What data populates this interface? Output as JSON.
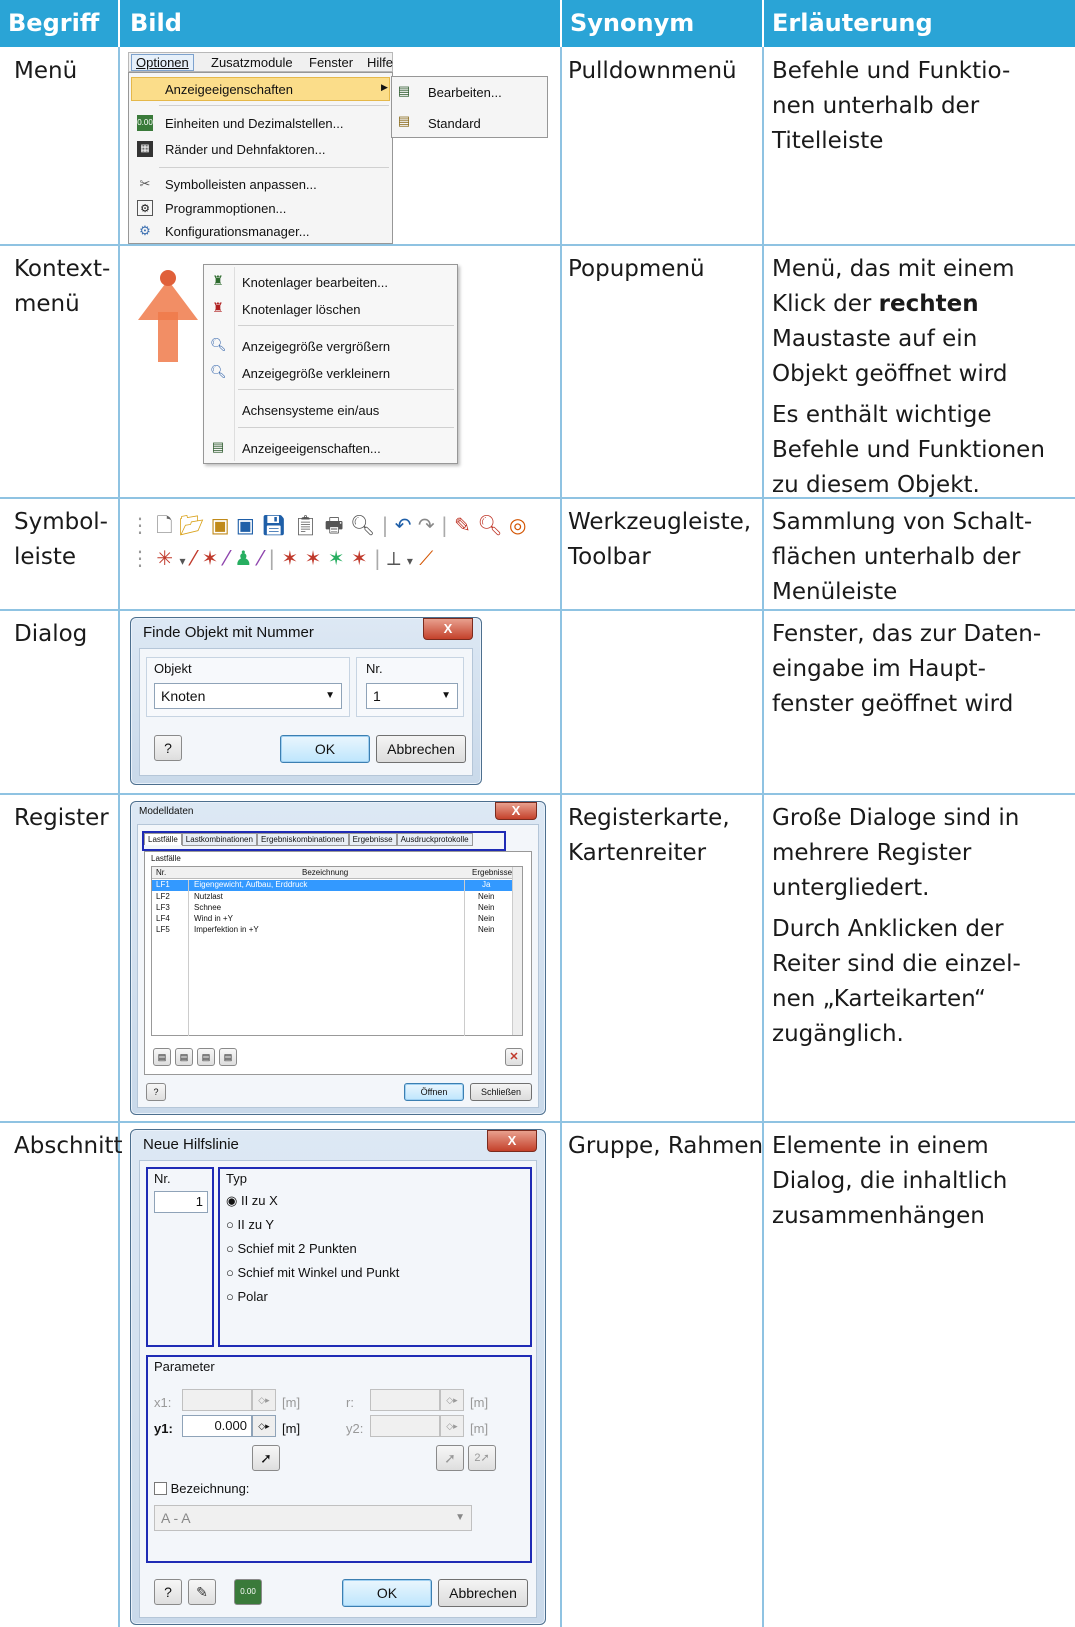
{
  "header": {
    "begriff": "Begriff",
    "bild": "Bild",
    "synonym": "Synonym",
    "erlaeuterung": "Erläuterung"
  },
  "rows": [
    {
      "begriff": "Menü",
      "synonym": "Pulldownmenü",
      "erlaeuterung": [
        "Befehle und Funktio-",
        "nen unterhalb der",
        "Titelleiste"
      ]
    },
    {
      "begriff": [
        "Kontext-",
        "menü"
      ],
      "synonym": "Popupmenü",
      "erlaeuterung_p1": [
        "Menü, das mit einem",
        "Klick der ",
        "rechten",
        "Maustaste auf ein",
        "Objekt geöffnet wird"
      ],
      "erlaeuterung_p2": [
        "Es enthält wichtige",
        "Befehle und Funktionen",
        "zu diesem Objekt."
      ]
    },
    {
      "begriff": [
        "Symbol-",
        "leiste"
      ],
      "synonym": [
        "Werkzeugleiste,",
        "Toolbar"
      ],
      "erlaeuterung": [
        "Sammlung von Schalt-",
        "flächen unterhalb der",
        "Menüleiste"
      ]
    },
    {
      "begriff": "Dialog",
      "synonym": "",
      "erlaeuterung": [
        "Fenster, das zur Daten-",
        "eingabe im Haupt-",
        "fenster geöffnet wird"
      ]
    },
    {
      "begriff": "Register",
      "synonym": [
        "Registerkarte,",
        "Kartenreiter"
      ],
      "erlaeuterung_p1": [
        "Große Dialoge sind in",
        "mehrere Register",
        "untergliedert."
      ],
      "erlaeuterung_p2": [
        "Durch Anklicken der",
        "Reiter sind die einzel-",
        "nen „Karteikarten“",
        "zugänglich."
      ]
    },
    {
      "begriff": "Abschnitt",
      "synonym": "Gruppe, Rahmen",
      "erlaeuterung": [
        "Elemente in einem",
        "Dialog, die inhaltlich",
        "zusammenhängen"
      ]
    }
  ],
  "menu_ui": {
    "menubar": [
      "Optionen",
      "Zusatzmodule",
      "Fenster",
      "Hilfe"
    ],
    "items": [
      "Anzeigeeigenschaften",
      "Einheiten und Dezimalstellen...",
      "Ränder und Dehnfaktoren...",
      "Symbolleisten anpassen...",
      "Programmoptionen...",
      "Konfigurationsmanager..."
    ],
    "submenu": [
      "Bearbeiten...",
      "Standard"
    ],
    "units_icon_text": "0.00"
  },
  "context_ui": {
    "items": [
      "Knotenlager bearbeiten...",
      "Knotenlager löschen",
      "Anzeigegröße vergrößern",
      "Anzeigegröße verkleinern",
      "Achsensysteme ein/aus",
      "Anzeigeeigenschaften..."
    ]
  },
  "dialog_ui": {
    "title": "Finde Objekt mit Nummer",
    "objekt_label": "Objekt",
    "objekt_value": "Knoten",
    "nr_label": "Nr.",
    "nr_value": "1",
    "ok": "OK",
    "cancel": "Abbrechen",
    "close": "X"
  },
  "register_ui": {
    "title": "Modelldaten",
    "tabs": [
      "Lastfälle",
      "Lastkombinationen",
      "Ergebniskombinationen",
      "Ergebnisse",
      "Ausdruckprotokolle"
    ],
    "group": "Lastfälle",
    "columns": [
      "Nr.",
      "Bezeichnung",
      "Ergebnisse"
    ],
    "rows": [
      [
        "LF1",
        "Eigengewicht, Aufbau, Erddruck",
        "Ja"
      ],
      [
        "LF2",
        "Nutzlast",
        "Nein"
      ],
      [
        "LF3",
        "Schnee",
        "Nein"
      ],
      [
        "LF4",
        "Wind in +Y",
        "Nein"
      ],
      [
        "LF5",
        "Imperfektion in +Y",
        "Nein"
      ]
    ],
    "open": "Öffnen",
    "close_btn": "Schließen",
    "close": "X"
  },
  "section_ui": {
    "title": "Neue Hilfslinie",
    "nr_label": "Nr.",
    "nr_value": "1",
    "typ_label": "Typ",
    "options": [
      "II zu X",
      "II zu Y",
      "Schief mit 2 Punkten",
      "Schief mit Winkel und Punkt",
      "Polar"
    ],
    "param_label": "Parameter",
    "x1": "x1:",
    "y1": "y1:",
    "r": "r:",
    "y2": "y2:",
    "unit": "[m]",
    "y1_value": "0.000",
    "bez_label": "Bezeichnung:",
    "bez_value": "A - A",
    "ok": "OK",
    "cancel": "Abbrechen",
    "close": "X",
    "units_icon_text": "0.00"
  }
}
